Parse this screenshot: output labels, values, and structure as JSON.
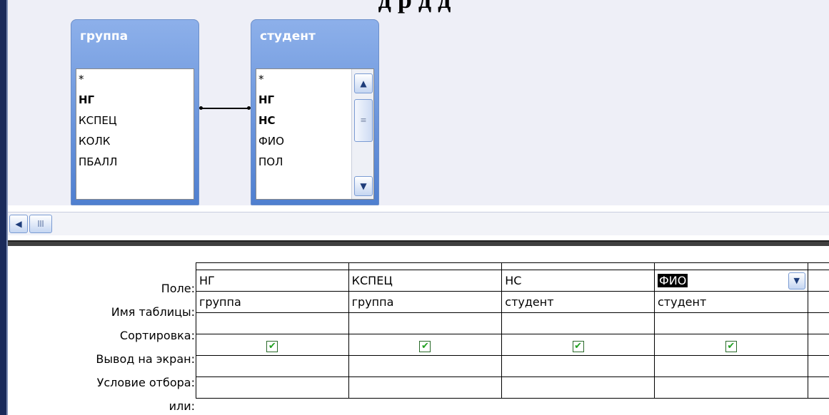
{
  "doc_title_fragment": "д    р    д    д",
  "tables": [
    {
      "name": "группа",
      "fields": [
        "*",
        "НГ",
        "КСПЕЦ",
        "КОЛК",
        "ПБАЛЛ"
      ],
      "bold": [
        false,
        true,
        false,
        false,
        false
      ]
    },
    {
      "name": "студент",
      "fields": [
        "*",
        "НГ",
        "НС",
        "ФИО",
        "ПОЛ"
      ],
      "bold": [
        false,
        true,
        true,
        false,
        false
      ]
    }
  ],
  "icons": {
    "scroll_up": "chevron-up-icon",
    "scroll_down": "chevron-down-icon",
    "thumb_grip": "grip-icon",
    "scroll_left": "chevron-left-icon"
  },
  "glyphs": {
    "up": "▲",
    "down": "▼",
    "left": "◀",
    "grip": "≡",
    "hgrip": "|||",
    "check": "✔"
  },
  "row_labels": [
    "Поле:",
    "Имя таблицы:",
    "Сортировка:",
    "Вывод на экран:",
    "Условие отбора:",
    "или:"
  ],
  "columns": [
    {
      "field": "НГ",
      "table": "группа",
      "sort": "",
      "show": true
    },
    {
      "field": "КСПЕЦ",
      "table": "группа",
      "sort": "",
      "show": true
    },
    {
      "field": "НС",
      "table": "студент",
      "sort": "",
      "show": true
    },
    {
      "field": "ФИО",
      "table": "студент",
      "sort": "",
      "show": true,
      "selected": true
    }
  ],
  "colors": {
    "table_header_top": "#8db0ea",
    "table_header_bottom": "#4f7fd0",
    "check": "#21a121",
    "diagram_bg": "#eeeff7"
  }
}
